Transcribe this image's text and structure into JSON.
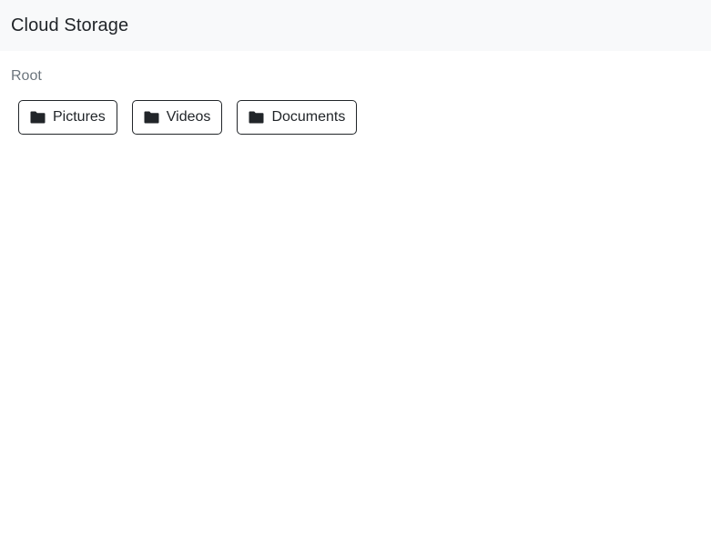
{
  "navbar": {
    "title": "Cloud Storage"
  },
  "breadcrumb": {
    "current": "Root"
  },
  "folders": [
    {
      "label": "Pictures",
      "icon": "folder-icon"
    },
    {
      "label": "Videos",
      "icon": "folder-icon"
    },
    {
      "label": "Documents",
      "icon": "folder-icon"
    }
  ],
  "colors": {
    "navbar_bg": "#f8f9fa",
    "text": "#212529",
    "breadcrumb_text": "#6c757d",
    "button_border": "#212529"
  }
}
